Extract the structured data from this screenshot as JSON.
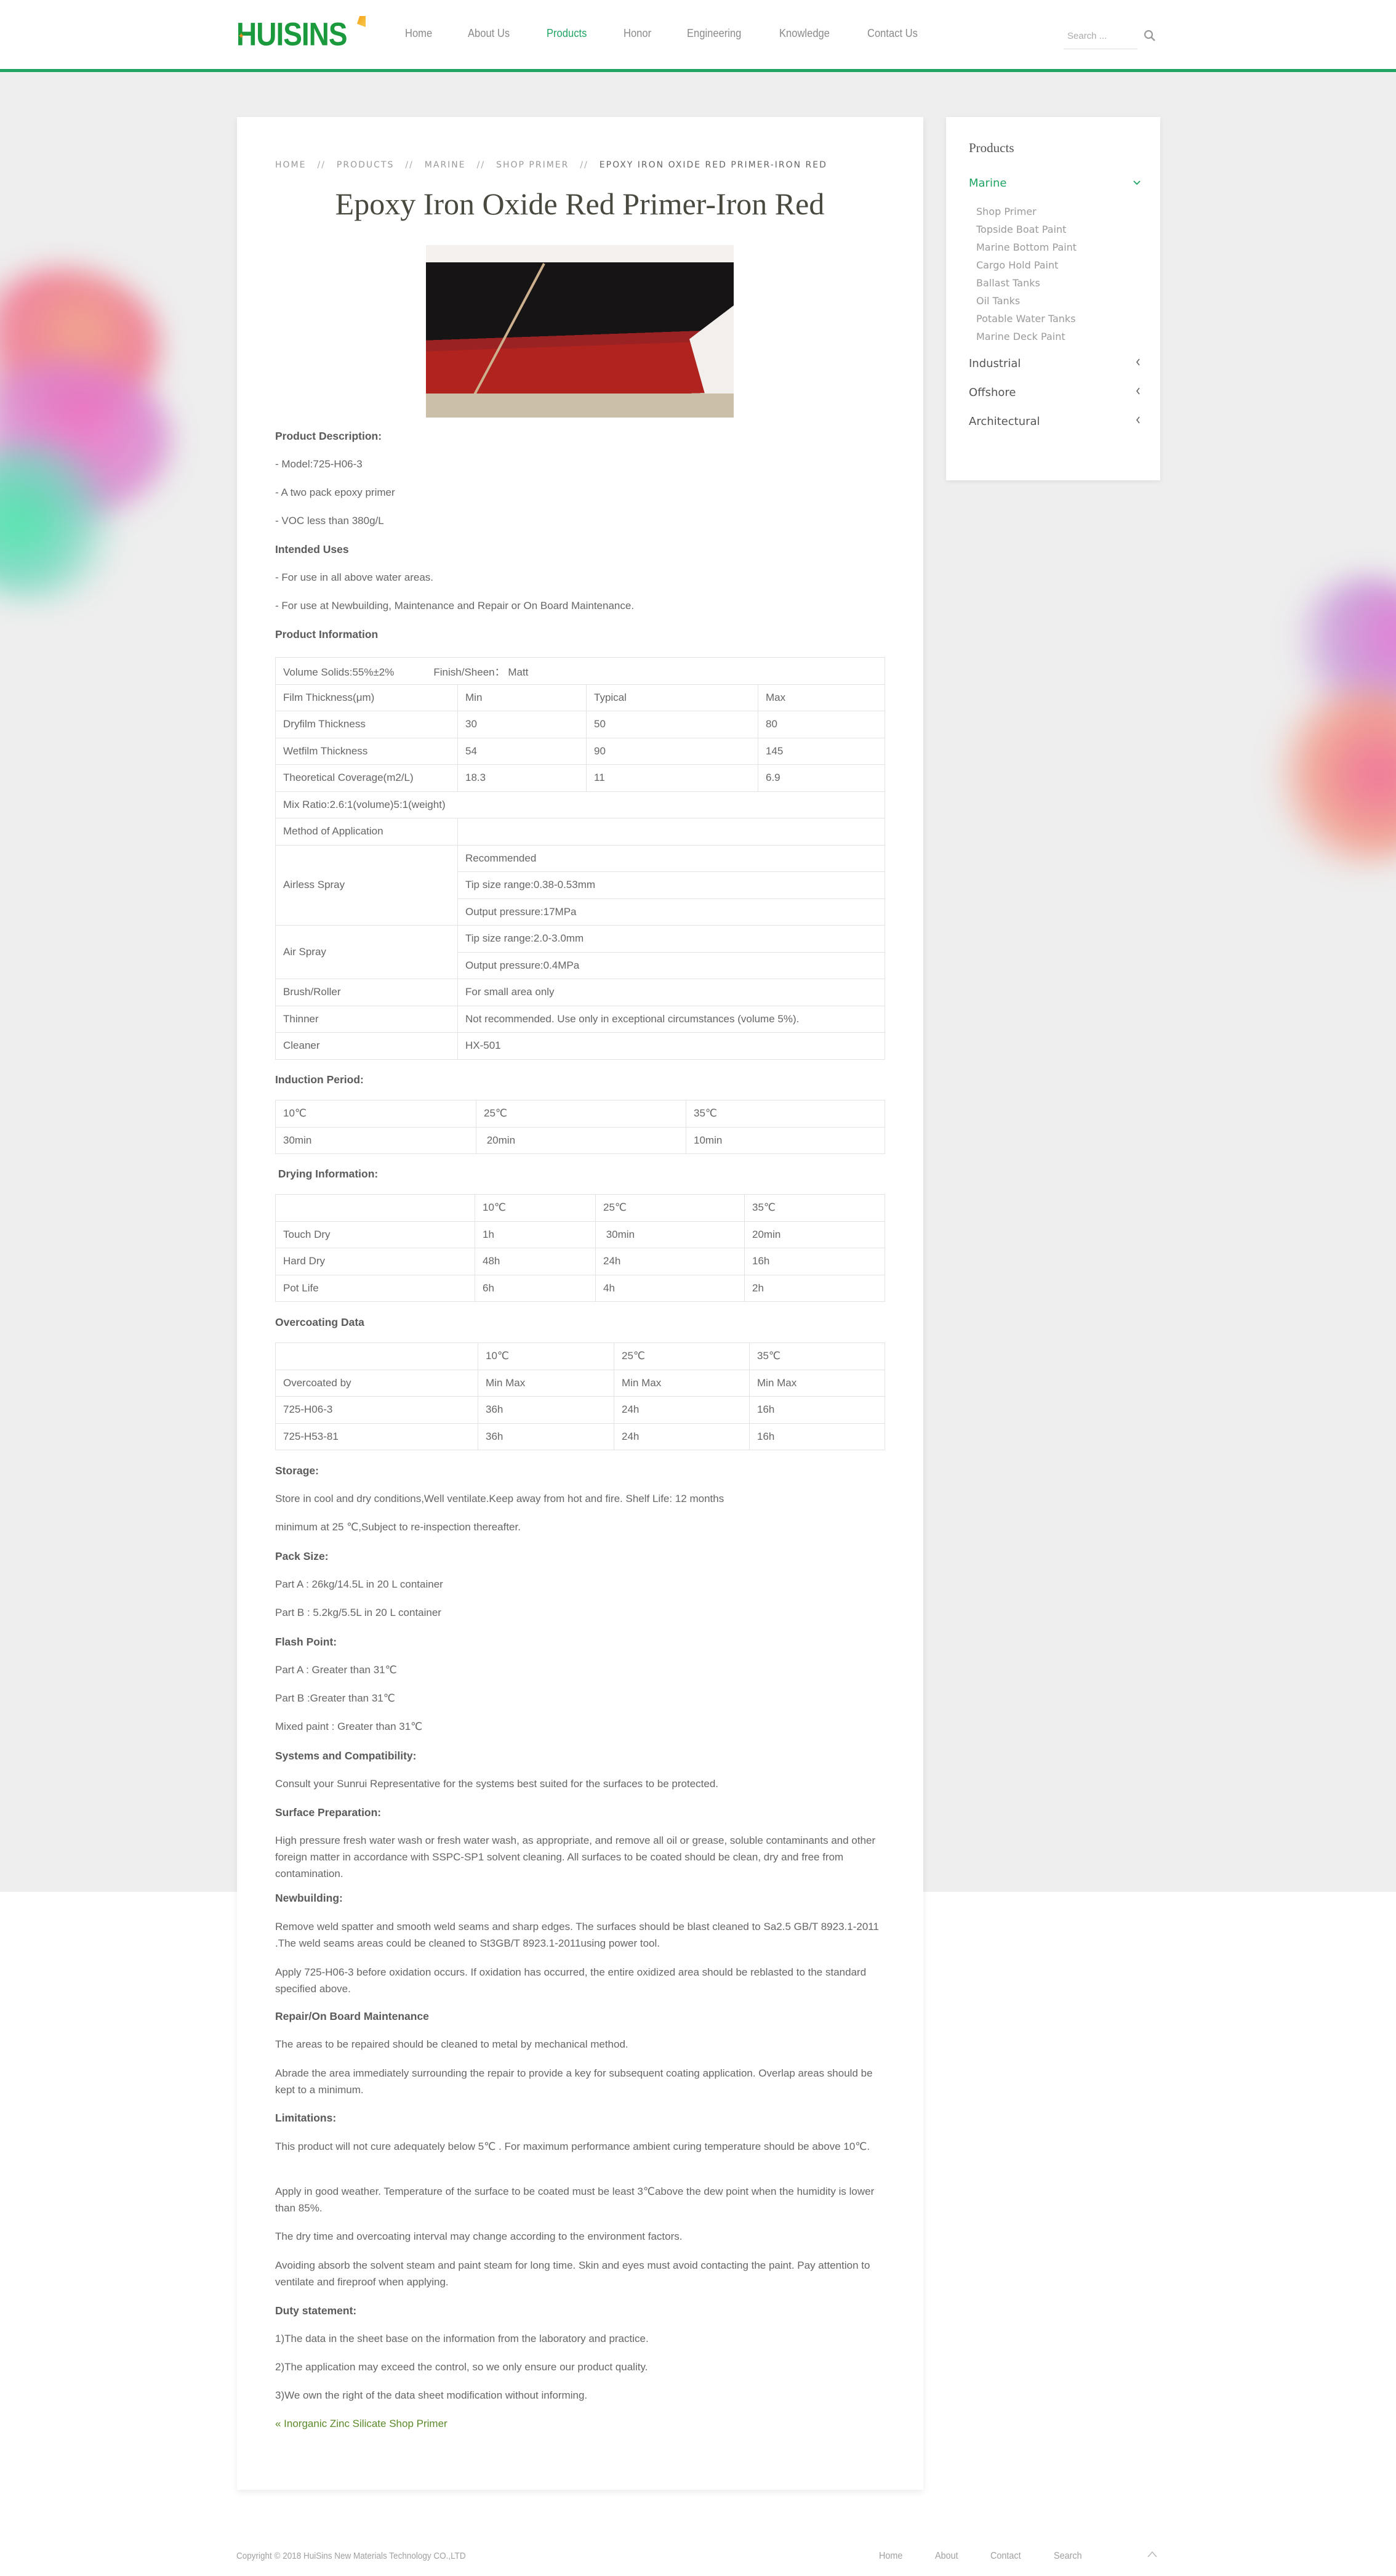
{
  "header": {
    "logo_text": "HUISINS",
    "nav": [
      {
        "label": "Home",
        "active": false
      },
      {
        "label": "About Us",
        "active": false
      },
      {
        "label": "Products",
        "active": true
      },
      {
        "label": "Honor",
        "active": false
      },
      {
        "label": "Engineering",
        "active": false
      },
      {
        "label": "Knowledge",
        "active": false
      },
      {
        "label": "Contact Us",
        "active": false
      }
    ],
    "search_placeholder": "Search ...",
    "search_value": "",
    "search_icon": "search-icon"
  },
  "colors": {
    "brand_green": "#1fa463",
    "text": "#606060",
    "border": "#e3e3e3",
    "link_prev": "#5c8a2a"
  },
  "breadcrumb": {
    "items": [
      "HOME",
      "PRODUCTS",
      "MARINE",
      "SHOP PRIMER"
    ],
    "separator": "//",
    "current": "EPOXY IRON OXIDE RED PRIMER-IRON RED"
  },
  "page_title": "Epoxy Iron Oxide Red Primer-Iron Red",
  "product_image_alt": "Ship hull painted with iron red primer",
  "description": {
    "heading": "Product Description:",
    "items": [
      "- Model:725-H06-3",
      "- A two pack epoxy primer",
      "- VOC less than 380g/L"
    ]
  },
  "intended_uses": {
    "heading": "Intended Uses",
    "items": [
      "- For use in all above water areas.",
      "- For use at Newbuilding, Maintenance and Repair or On Board Maintenance."
    ]
  },
  "product_info": {
    "heading": "Product Information",
    "volume_solids": "Volume Solids:55%±2%",
    "finish": "Finish/Sheen： Matt",
    "thickness_header": [
      "Film Thickness(μm)",
      "Min",
      "Typical",
      "Max"
    ],
    "thickness_rows": [
      [
        "Dryfilm Thickness",
        "30",
        "50",
        "80"
      ],
      [
        "Wetfilm Thickness",
        "54",
        "90",
        "145"
      ],
      [
        "Theoretical Coverage(m2/L)",
        "18.3",
        "11",
        "6.9"
      ]
    ],
    "mix_ratio": "Mix Ratio:2.6:1(volume)5:1(weight)",
    "method_label": "Method of Application",
    "airless_label": "Airless Spray",
    "airless_values": [
      "Recommended",
      "Tip size range:0.38-0.53mm",
      "Output pressure:17MPa"
    ],
    "air_label": "Air Spray",
    "air_values": [
      "Tip size range:2.0-3.0mm",
      "Output pressure:0.4MPa"
    ],
    "other_rows": [
      [
        "Brush/Roller",
        "For small area only"
      ],
      [
        "Thinner",
        "Not recommended. Use only in exceptional circumstances (volume 5%)."
      ],
      [
        "Cleaner",
        "HX-501"
      ]
    ]
  },
  "induction": {
    "heading": "Induction Period:",
    "temps": [
      "10℃",
      "25℃",
      "35℃"
    ],
    "values": [
      "30min",
      " 20min",
      "10min"
    ]
  },
  "drying": {
    "heading": " Drying Information:",
    "temps": [
      "",
      "10℃",
      "25℃",
      "35℃"
    ],
    "rows": [
      [
        "Touch Dry",
        "1h",
        " 30min",
        "20min"
      ],
      [
        "Hard Dry",
        "48h",
        "24h",
        "16h"
      ],
      [
        "Pot Life",
        "6h",
        "4h",
        "2h"
      ]
    ]
  },
  "overcoating": {
    "heading": "Overcoating Data",
    "temps": [
      "",
      "10℃",
      "25℃",
      "35℃"
    ],
    "rows": [
      [
        "Overcoated by",
        "Min Max",
        "Min Max",
        "Min Max"
      ],
      [
        "725-H06-3",
        "36h",
        "24h",
        "16h"
      ],
      [
        "725-H53-81",
        "36h",
        "24h",
        "16h"
      ]
    ]
  },
  "storage": {
    "heading": "Storage:",
    "lines": [
      "Store in cool and dry conditions,Well ventilate.Keep away from hot and fire. Shelf Life: 12 months",
      "minimum at 25 ℃,Subject to re-inspection thereafter."
    ]
  },
  "pack_size": {
    "heading": "Pack Size:",
    "lines": [
      "Part A : 26kg/14.5L in 20 L container",
      "Part B : 5.2kg/5.5L in 20 L container"
    ]
  },
  "flash_point": {
    "heading": "Flash Point:",
    "lines": [
      "Part A : Greater than 31℃",
      "Part B :Greater than 31℃",
      "Mixed paint : Greater than 31℃"
    ]
  },
  "systems": {
    "heading": "Systems and Compatibility:",
    "text": "Consult your Sunrui Representative for the systems best suited for the surfaces to be protected."
  },
  "surface_prep": {
    "heading": "Surface Preparation:",
    "text": "High pressure fresh water wash or fresh water wash, as appropriate, and remove all oil or grease, soluble contaminants and other foreign matter in accordance with SSPC-SP1 solvent cleaning. All surfaces to be coated should be clean, dry and free from contamination."
  },
  "newbuilding": {
    "heading": "Newbuilding:",
    "paragraphs": [
      "Remove weld spatter and smooth weld seams and sharp edges. The surfaces should be blast cleaned to Sa2.5 GB/T 8923.1-2011 .The weld seams areas could be cleaned to St3GB/T 8923.1-2011using power tool.",
      "Apply 725-H06-3 before oxidation occurs. If oxidation has occurred, the entire oxidized area should be reblasted to the standard specified above."
    ]
  },
  "repair": {
    "heading": "Repair/On Board Maintenance",
    "paragraphs": [
      "The areas to be repaired should be cleaned to metal by mechanical method.",
      "Abrade the area immediately surrounding the repair to provide a key for subsequent coating application. Overlap areas should be kept to a minimum."
    ]
  },
  "limitations": {
    "heading": "Limitations:",
    "paragraphs": [
      "This product will not cure adequately below 5℃ . For maximum performance ambient curing temperature should be above 10℃.",
      "Apply in good weather. Temperature of the surface to be coated must be least 3℃above the dew point when the humidity is lower than 85%.",
      "The dry time and overcoating interval may change according to the environment factors.",
      "Avoiding absorb the solvent steam and paint steam for long time. Skin and eyes must avoid contacting the paint. Pay attention to ventilate and fireproof when applying."
    ]
  },
  "duty": {
    "heading": "Duty statement:",
    "lines": [
      "1)The data in the sheet base on the information from the laboratory and practice.",
      "2)The application may exceed the control, so we only ensure our product quality.",
      "3)We own the right of the data sheet modification without informing."
    ]
  },
  "prev_link": "« Inorganic Zinc Silicate Shop Primer",
  "sidebar": {
    "title": "Products",
    "categories": [
      {
        "label": "Marine",
        "active": true,
        "expanded": true,
        "children": [
          "Shop Primer",
          "Topside Boat Paint",
          "Marine Bottom Paint",
          "Cargo Hold Paint",
          "Ballast Tanks",
          "Oil Tanks",
          "Potable Water Tanks",
          "Marine Deck Paint"
        ]
      },
      {
        "label": "Industrial",
        "active": false,
        "expanded": false
      },
      {
        "label": "Offshore",
        "active": false,
        "expanded": false
      },
      {
        "label": "Architectural",
        "active": false,
        "expanded": false
      }
    ],
    "chevron_down": "⌄",
    "chevron_left": "‹"
  },
  "footer": {
    "copyright": "Copyright © 2018 HuiSins New Materials Technology CO.,LTD",
    "links": [
      "Home",
      "About",
      "Contact",
      "Search"
    ],
    "back_to_top": "^"
  }
}
